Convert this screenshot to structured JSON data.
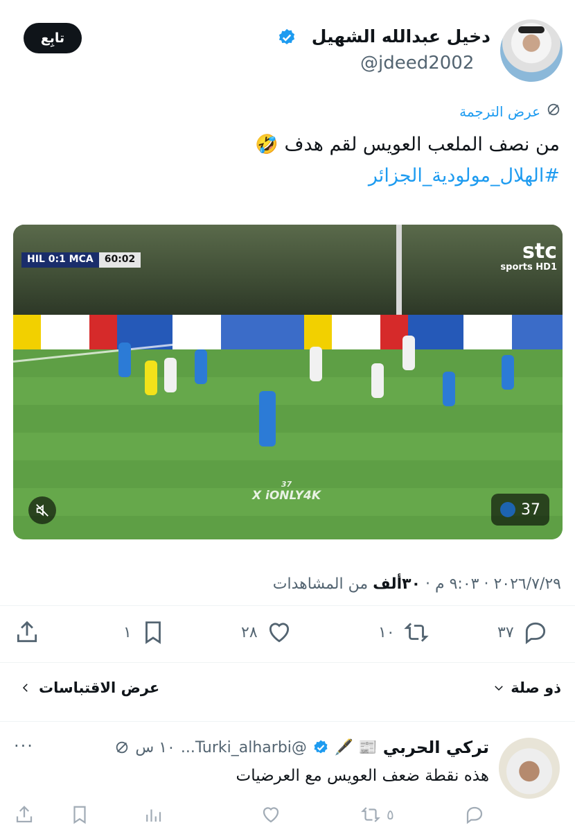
{
  "author": {
    "display_name": "دخيل عبدالله الشهيل",
    "handle": "@jdeed2002",
    "follow_label": "تابِع",
    "verified": true
  },
  "tweet": {
    "translate_label": "عرض الترجمة",
    "text_line1": "من نصف الملعب العويس لقم هدف 🤣",
    "hashtag": "#الهلال_مولودية_الجزائر"
  },
  "video": {
    "scoreboard_teams": "HIL 0:1 MCA",
    "scoreboard_clock": "60:02",
    "broadcaster": "stc",
    "broadcaster_sub": "sports HD1",
    "watermark": "X iONLY4K",
    "watermark_number": "37",
    "view_count": "37"
  },
  "meta": {
    "date_time": "٢٠٢٦/٧/٢٩ · ٩:٠٣ م · ",
    "views_value": "٣٠ألف",
    "views_label": " من المشاهدات"
  },
  "actions": {
    "replies": "٣٧",
    "retweets": "١٠",
    "likes": "٢٨",
    "bookmarks": "١"
  },
  "sorting": {
    "relevance_label": "ذو صلة",
    "quotes_label": "عرض الاقتباسات"
  },
  "reply": {
    "name": "تركي الحربي",
    "emojis": "📰 🖋️",
    "handle": "@Turki_alharbi...",
    "time": "١٠ س",
    "text": "هذه نقطة ضعف العويس مع العرضيات",
    "more": "···",
    "retweets": "٥"
  },
  "colors": {
    "accent": "#1d9bf0",
    "text": "#0f1419",
    "muted": "#536471"
  }
}
